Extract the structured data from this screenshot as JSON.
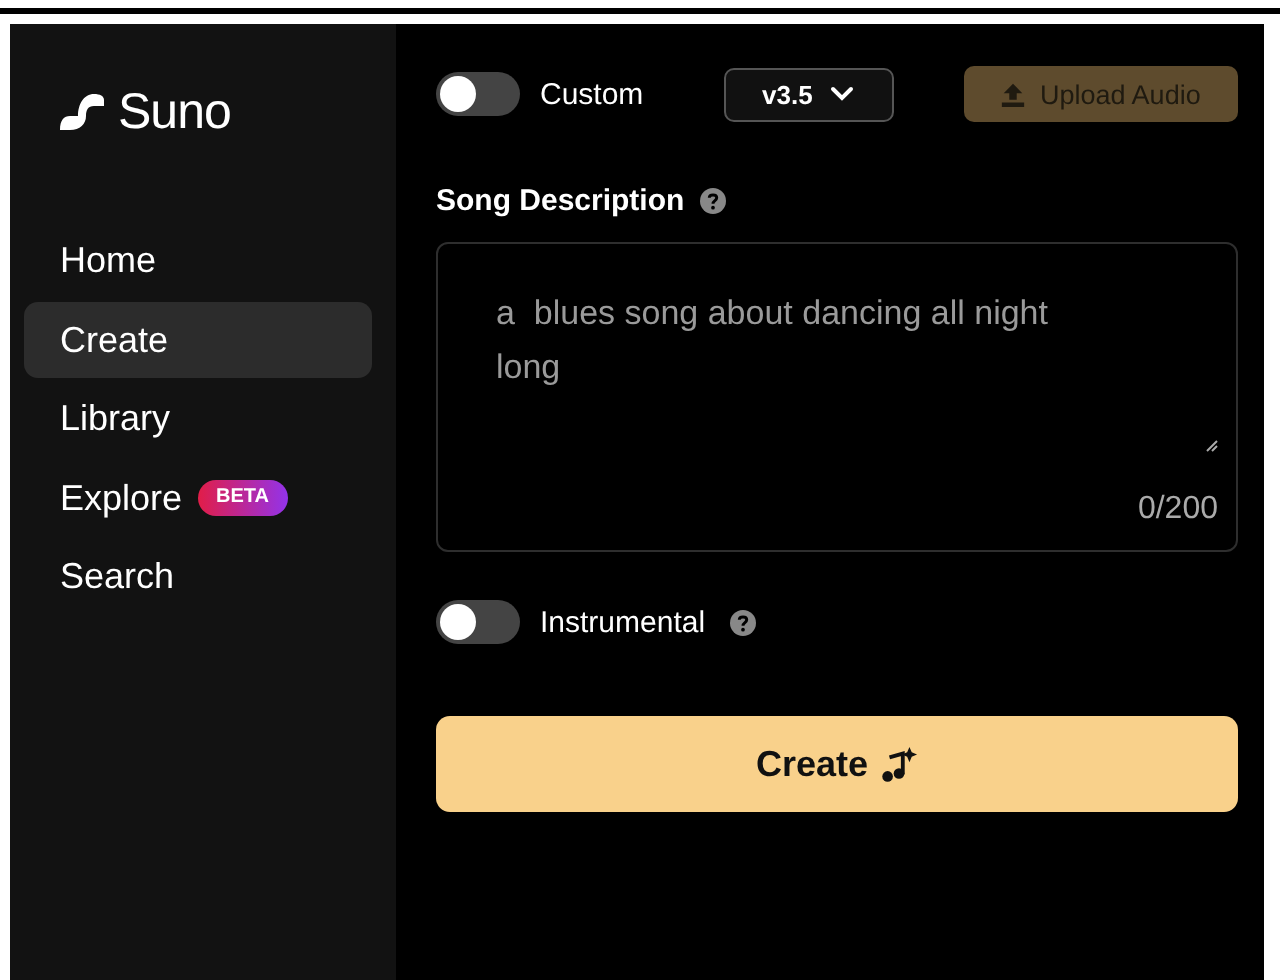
{
  "sidebar": {
    "logo": "Suno",
    "items": [
      {
        "label": "Home",
        "selected": false
      },
      {
        "label": "Create",
        "selected": true
      },
      {
        "label": "Library",
        "selected": false
      },
      {
        "label": "Explore",
        "selected": false,
        "badge": "BETA"
      },
      {
        "label": "Search",
        "selected": false
      }
    ]
  },
  "toolbar": {
    "custom_toggle": {
      "label": "Custom",
      "on": false
    },
    "version": "v3.5",
    "upload_button": "Upload Audio"
  },
  "description": {
    "label": "Song Description",
    "placeholder": "a  blues song about dancing all night long",
    "counter": "0/200"
  },
  "instrumental_toggle": {
    "label": "Instrumental",
    "on": false
  },
  "create_button": "Create"
}
